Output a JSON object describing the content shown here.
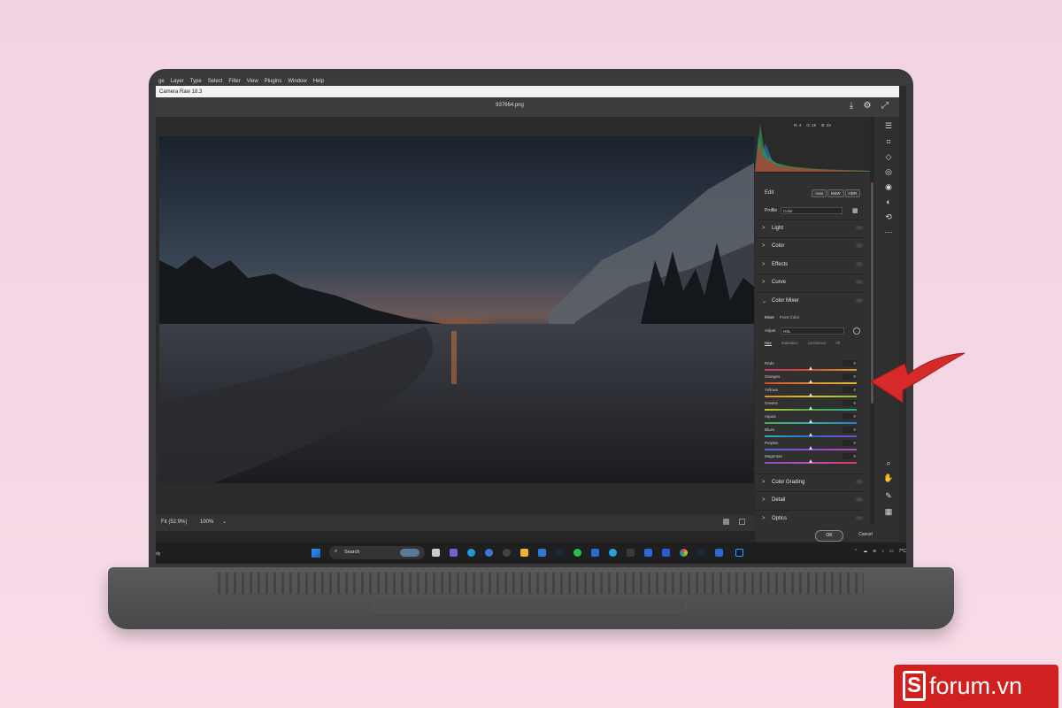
{
  "ps_menu": [
    "ge",
    "Layer",
    "Type",
    "Select",
    "Filter",
    "View",
    "Plugins",
    "Window",
    "Help"
  ],
  "window_title": "Camera Raw 18.3",
  "file_name": "937664.png",
  "histogram": {
    "r": "R: 4",
    "g": "G: 16",
    "b": "B: 23"
  },
  "edit": {
    "label": "Edit",
    "auto": "Auto",
    "bw": "B&W",
    "hdr": "HDR"
  },
  "profile": {
    "label": "Profile",
    "value": "Color"
  },
  "sections_top": [
    "Light",
    "Color",
    "Effects",
    "Curve"
  ],
  "color_mixer": {
    "label": "Color Mixer",
    "tabs": [
      "Mixer",
      "Point Color"
    ],
    "adjust_label": "Adjust",
    "adjust_value": "HSL",
    "hsl_tabs": [
      "Hue",
      "Saturation",
      "Luminance",
      "All"
    ],
    "sliders": [
      {
        "name": "Reds",
        "value": "0"
      },
      {
        "name": "Oranges",
        "value": "0"
      },
      {
        "name": "Yellows",
        "value": "0"
      },
      {
        "name": "Greens",
        "value": "0"
      },
      {
        "name": "Aquas",
        "value": "0"
      },
      {
        "name": "Blues",
        "value": "0"
      },
      {
        "name": "Purples",
        "value": "0"
      },
      {
        "name": "Magentas",
        "value": "0"
      }
    ]
  },
  "sections_bottom": [
    "Color Grading",
    "Detail",
    "Optics"
  ],
  "zoom": {
    "fit": "Fit (52.9%)",
    "pct": "100%"
  },
  "buttons": {
    "ok": "OK",
    "cancel": "Cancel"
  },
  "status_left": "dy",
  "taskbar": {
    "search": "Search",
    "time": "7°C"
  },
  "brand": {
    "text": "forum.vn",
    "letter": "S"
  },
  "colors": {
    "accent_red": "#d0201f",
    "panel_bg": "#303030"
  }
}
